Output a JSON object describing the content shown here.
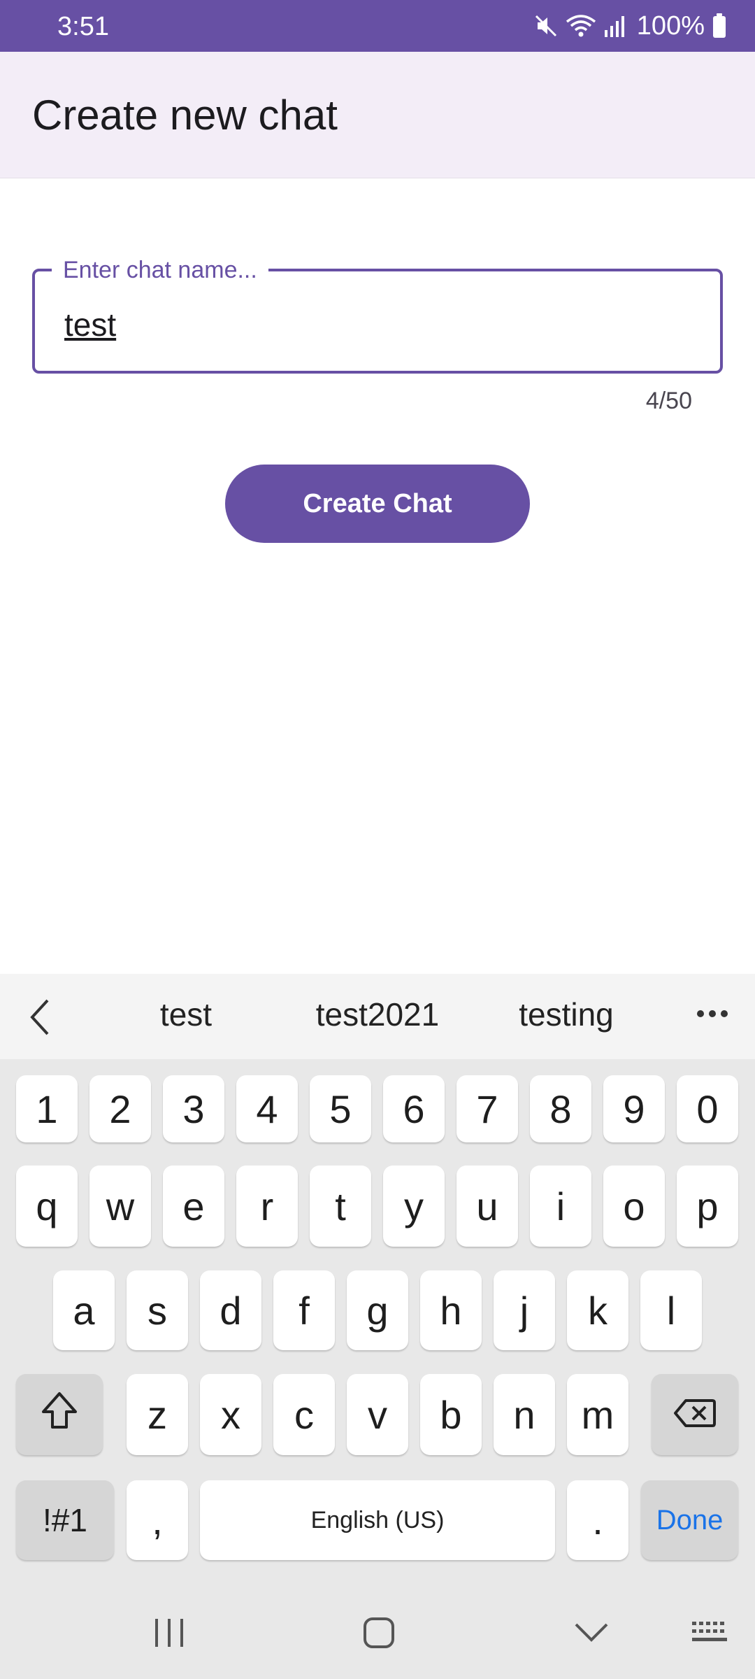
{
  "status": {
    "time": "3:51",
    "battery": "100%",
    "icons": [
      "mute-icon",
      "wifi-icon",
      "signal-icon",
      "battery-icon"
    ]
  },
  "app_bar": {
    "title": "Create new chat"
  },
  "form": {
    "field_label": "Enter chat name...",
    "field_value": "test",
    "counter": "4/50",
    "button_label": "Create Chat"
  },
  "keyboard": {
    "suggestions": [
      "test",
      "test2021",
      "testing"
    ],
    "row_numbers": [
      "1",
      "2",
      "3",
      "4",
      "5",
      "6",
      "7",
      "8",
      "9",
      "0"
    ],
    "row1": [
      "q",
      "w",
      "e",
      "r",
      "t",
      "y",
      "u",
      "i",
      "o",
      "p"
    ],
    "row2": [
      "a",
      "s",
      "d",
      "f",
      "g",
      "h",
      "j",
      "k",
      "l"
    ],
    "row3": [
      "z",
      "x",
      "c",
      "v",
      "b",
      "n",
      "m"
    ],
    "symbols_label": "!#1",
    "comma_label": ",",
    "space_label": "English (US)",
    "period_label": ".",
    "done_label": "Done"
  },
  "colors": {
    "primary": "#6750a4",
    "app_bar_bg": "#f3edf7",
    "keyboard_bg": "#e8e8e8",
    "done_blue": "#1a73e8"
  }
}
